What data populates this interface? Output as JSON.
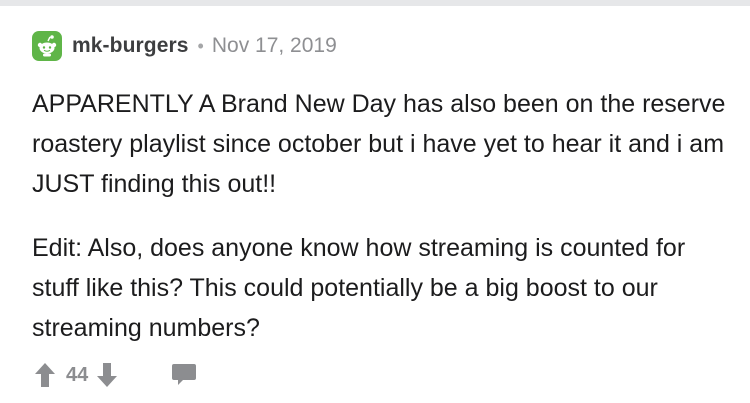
{
  "comment": {
    "username": "mk-burgers",
    "separator": "•",
    "date": "Nov 17, 2019",
    "paragraphs": [
      "APPARENTLY A Brand New Day has also been on the reserve roastery playlist since october but i have yet to hear it and i am JUST finding this out!!",
      "Edit: Also, does anyone know how streaming is counted for stuff like this? This could potentially be a big boost to our streaming numbers?"
    ],
    "score": "44"
  },
  "icons": {
    "avatar": "reddit-snoo-avatar-icon",
    "upvote": "upvote-arrow-icon",
    "downvote": "downvote-arrow-icon",
    "reply": "comment-bubble-icon"
  },
  "colors": {
    "avatar_bg": "#5fb548",
    "username": "#3d3e40",
    "meta": "#8e8f92",
    "action_icons": "#8c8d90",
    "top_rule": "#e6e7e9"
  }
}
